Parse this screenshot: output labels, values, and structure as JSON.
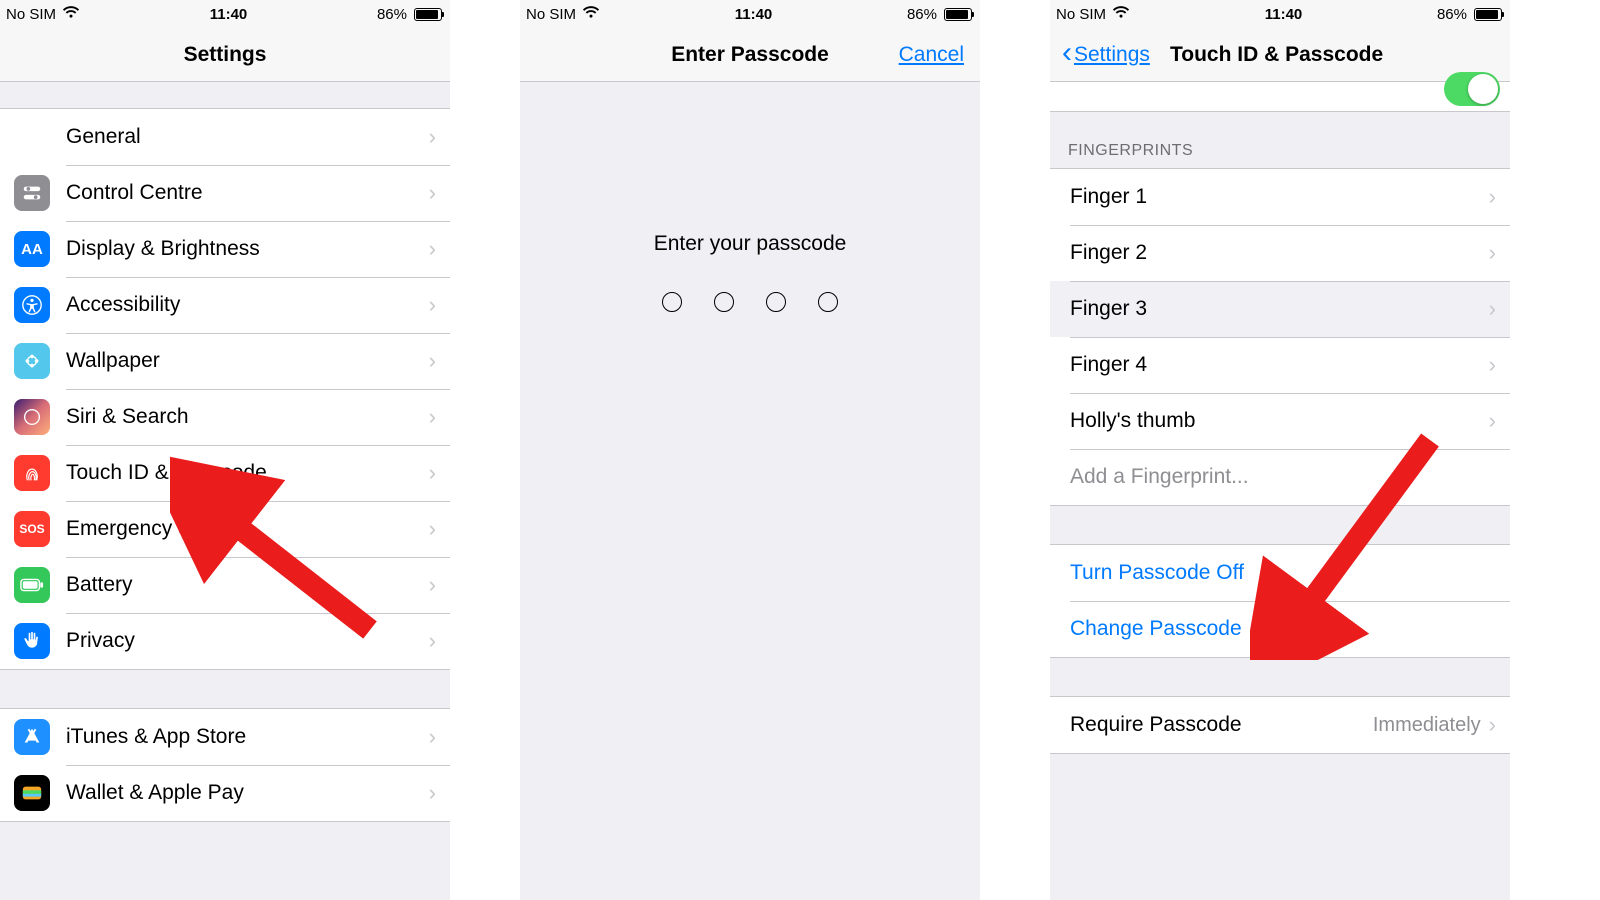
{
  "status": {
    "carrier": "No SIM",
    "time": "11:40",
    "battery_pct": "86%"
  },
  "screen1": {
    "title": "Settings",
    "items": [
      {
        "label": "General"
      },
      {
        "label": "Control Centre"
      },
      {
        "label": "Display & Brightness"
      },
      {
        "label": "Accessibility"
      },
      {
        "label": "Wallpaper"
      },
      {
        "label": "Siri & Search"
      },
      {
        "label": "Touch ID & Passcode"
      },
      {
        "label": "Emergency SOS"
      },
      {
        "label": "Battery"
      },
      {
        "label": "Privacy"
      }
    ],
    "items2": [
      {
        "label": "iTunes & App Store"
      },
      {
        "label": "Wallet & Apple Pay"
      }
    ]
  },
  "screen2": {
    "title": "Enter Passcode",
    "cancel": "Cancel",
    "prompt": "Enter your passcode"
  },
  "screen3": {
    "back": "Settings",
    "title": "Touch ID & Passcode",
    "section_fingerprints": "FINGERPRINTS",
    "fingerprints": [
      "Finger 1",
      "Finger 2",
      "Finger 3",
      "Finger 4",
      "Holly's thumb"
    ],
    "add_fingerprint": "Add a Fingerprint...",
    "turn_off": "Turn Passcode Off",
    "change": "Change Passcode",
    "require": {
      "label": "Require Passcode",
      "value": "Immediately"
    }
  },
  "colors": {
    "general": "#8e8e93",
    "control": "#8e8e93",
    "display": "#007aff",
    "accessibility": "#007aff",
    "wallpaper": "#54c7ec",
    "siri": "#1c1c1e",
    "touchid": "#ff3b30",
    "sos": "#ff3b30",
    "battery": "#34c759",
    "privacy": "#007aff",
    "itunes": "#1e90ff",
    "wallet": "#000000"
  },
  "icon_text": {
    "display": "AA",
    "sos": "SOS"
  }
}
